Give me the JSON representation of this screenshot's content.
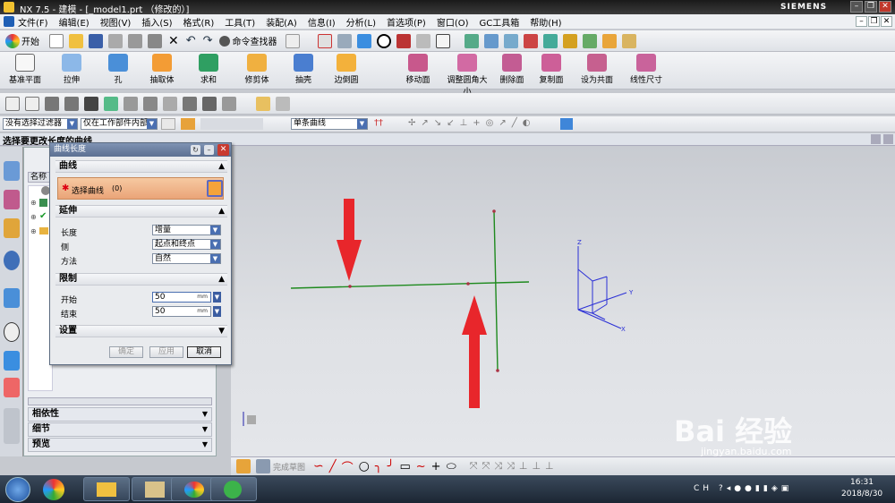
{
  "window": {
    "title": "NX 7.5 - 建模 - [_model1.prt （修改的）]",
    "brand": "SIEMENS"
  },
  "menu": {
    "items": [
      "文件(F)",
      "编辑(E)",
      "视图(V)",
      "插入(S)",
      "格式(R)",
      "工具(T)",
      "装配(A)",
      "信息(I)",
      "分析(L)",
      "首选项(P)",
      "窗口(O)",
      "GC工具箱",
      "帮助(H)"
    ]
  },
  "toolbar1": {
    "start_label": "开始",
    "command_finder_label": "命令查找器"
  },
  "toolbar2": {
    "buttons": [
      "基准平面",
      "拉伸",
      "孔",
      "抽取体",
      "求和",
      "修剪体",
      "抽壳",
      "边倒圆",
      "移动面",
      "调整圆角大小",
      "删除面",
      "复制面",
      "设为共面",
      "线性尺寸"
    ]
  },
  "selection_bar": {
    "filter": "没有选择过滤器",
    "scope": "仅在工作部件内部",
    "curve_rule": "单条曲线"
  },
  "prompt": "选择要更改长度的曲线",
  "nav_panel": {
    "header_label": "名称",
    "sections": [
      "相依性",
      "细节",
      "预览"
    ]
  },
  "dialog": {
    "title": "曲线长度",
    "curve_section": "曲线",
    "select_curve_label": "选择曲线",
    "select_curve_count": "(0)",
    "extend_section": "延伸",
    "length_label": "长度",
    "length_value": "增量",
    "side_label": "侧",
    "side_value": "起点和终点",
    "method_label": "方法",
    "method_value": "自然",
    "limits_section": "限制",
    "start_label": "开始",
    "start_value": "50",
    "end_label": "结束",
    "end_value": "50",
    "unit": "mm",
    "settings_section": "设置",
    "ok_label": "确定",
    "apply_label": "应用",
    "cancel_label": "取消"
  },
  "triad": {
    "x": "X",
    "y": "Y",
    "z": "Z"
  },
  "sketch_bar": {
    "finish_label": "完成草图"
  },
  "watermark": {
    "site": "jingyan.baidu.com"
  },
  "taskbar": {
    "time": "16:31",
    "date": "2018/8/30"
  },
  "colors": {
    "curve_green": "#1e8a1e",
    "arrow_red": "#e8262b",
    "triad_blue": "#2a2fd6",
    "dialog_title": "#6a7fa2"
  }
}
